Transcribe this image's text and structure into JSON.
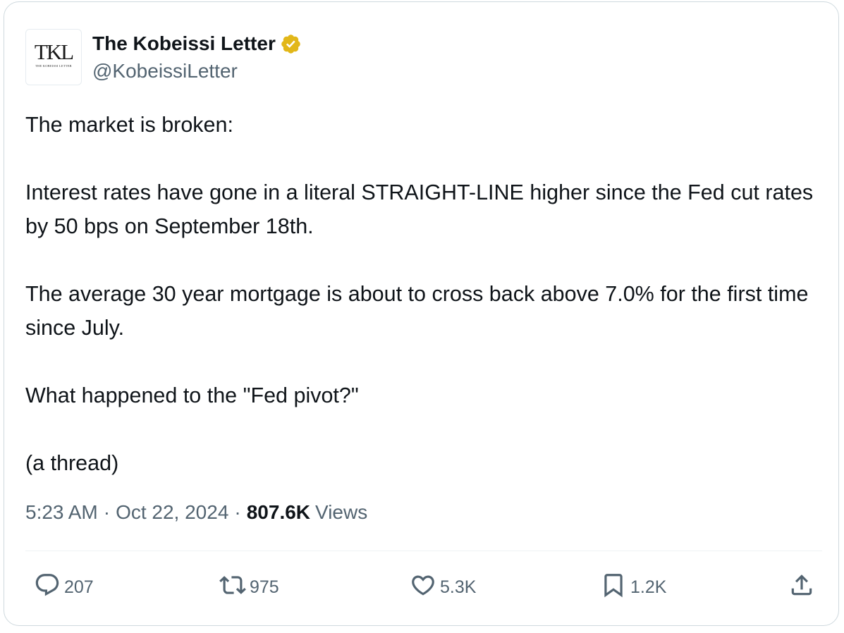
{
  "author": {
    "avatar_text": "TKL",
    "avatar_subtext": "THE KOBEISSI LETTER",
    "display_name": "The Kobeissi Letter",
    "handle": "@KobeissiLetter",
    "verified_badge": "verified-badge-icon",
    "badge_color": "#e2b719"
  },
  "tweet": {
    "paragraphs": [
      "The market is broken:",
      "Interest rates have gone in a literal STRAIGHT-LINE higher since the Fed cut rates by 50 bps on September 18th.",
      "The average 30 year mortgage is about to cross back above 7.0% for the first time since July.",
      "What happened to the \"Fed pivot?\"",
      "(a thread)"
    ]
  },
  "meta": {
    "time": "5:23 AM",
    "separator": "·",
    "date": "Oct 22, 2024",
    "views_count": "807.6K",
    "views_label": "Views"
  },
  "actions": {
    "reply": {
      "icon": "reply-icon",
      "count": "207"
    },
    "repost": {
      "icon": "repost-icon",
      "count": "975"
    },
    "like": {
      "icon": "heart-icon",
      "count": "5.3K"
    },
    "bookmark": {
      "icon": "bookmark-icon",
      "count": "1.2K"
    },
    "share": {
      "icon": "share-icon"
    }
  },
  "colors": {
    "text_primary": "#0f1419",
    "text_secondary": "#536471",
    "border": "#cfd9de"
  }
}
